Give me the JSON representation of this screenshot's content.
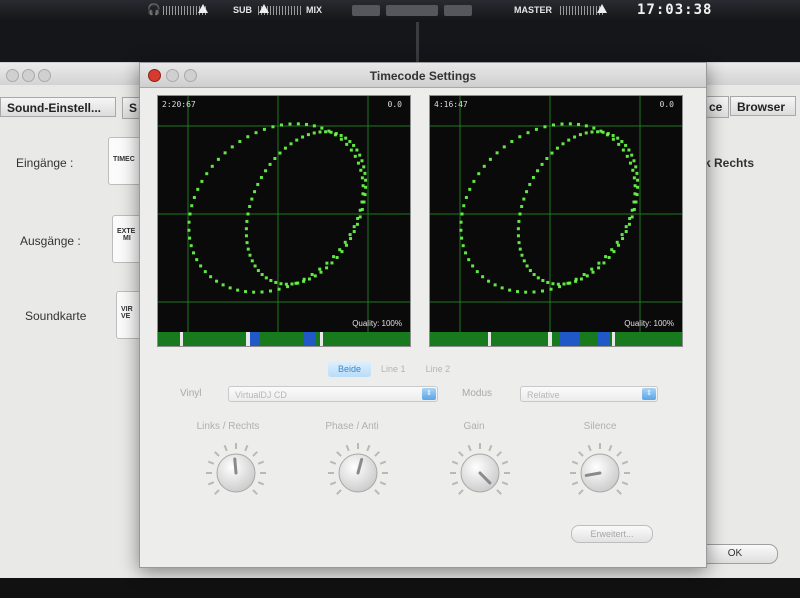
{
  "topbar": {
    "sub_label": "SUB",
    "mix_label": "MIX",
    "master_label": "MASTER",
    "clock": "17:03:38"
  },
  "background_window": {
    "tabs": [
      "Sound-Einstell...",
      "S",
      "ce",
      "Browser"
    ],
    "inputs_label": "Eingänge :",
    "outputs_label": "Ausgänge :",
    "soundcard_label": "Soundkarte",
    "input_box": "TIMEC",
    "output_box_1": "EXTE",
    "output_box_2": "MI",
    "soundcard_box_1": "VIR",
    "soundcard_box_2": "VE",
    "right_field": "k Rechts",
    "ok_label": "OK"
  },
  "dialog": {
    "title": "Timecode Settings",
    "scopes": [
      {
        "timestamp": "2:20:67",
        "pitch": "0.0",
        "quality": "Quality: 100%"
      },
      {
        "timestamp": "4:16:47",
        "pitch": "0.0",
        "quality": "Quality: 100%"
      }
    ],
    "segments": [
      "Beide",
      "Line 1",
      "Line 2"
    ],
    "vinyl_label": "Vinyl",
    "vinyl_value": "VirtualDJ CD",
    "modus_label": "Modus",
    "modus_value": "Relative",
    "knobs": [
      "Links / Rechts",
      "Phase / Anti",
      "Gain",
      "Silence"
    ],
    "advanced_label": "Erweitert..."
  },
  "colors": {
    "scope_dots": "#6dff4a",
    "grid": "#1f7a1f",
    "accent_blue": "#5aa5e6"
  }
}
